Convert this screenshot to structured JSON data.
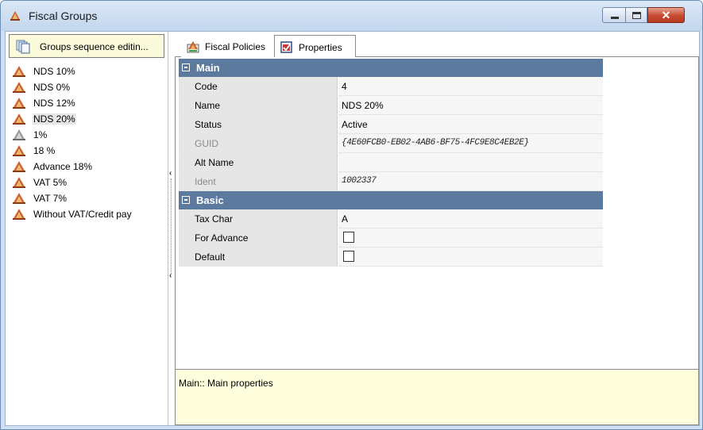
{
  "window": {
    "title": "Fiscal Groups",
    "buttons": {
      "minimize": "",
      "maximize": "",
      "close": "✕"
    }
  },
  "left_panel": {
    "sequence_button": "Groups sequence editin...",
    "items": [
      {
        "label": "NDS 10%",
        "icon": "fiscal-group-icon"
      },
      {
        "label": "NDS 0%",
        "icon": "fiscal-group-icon"
      },
      {
        "label": "NDS 12%",
        "icon": "fiscal-group-icon"
      },
      {
        "label": "NDS 20%",
        "icon": "fiscal-group-icon",
        "selected": true
      },
      {
        "label": "1%",
        "icon": "fiscal-group-disabled-icon"
      },
      {
        "label": "18 %",
        "icon": "fiscal-group-icon"
      },
      {
        "label": "Advance 18%",
        "icon": "fiscal-group-icon"
      },
      {
        "label": "VAT 5%",
        "icon": "fiscal-group-icon"
      },
      {
        "label": "VAT 7%",
        "icon": "fiscal-group-icon"
      },
      {
        "label": "Without VAT/Credit pay",
        "icon": "fiscal-group-icon"
      }
    ]
  },
  "splitter": {
    "arrow_top": "‹",
    "arrow_bottom": "‹"
  },
  "tabs": [
    {
      "label": "Fiscal Policies",
      "icon": "fiscal-policies-icon"
    },
    {
      "label": "Properties",
      "icon": "properties-icon",
      "active": true
    }
  ],
  "property_grid": {
    "main": {
      "category": "Main",
      "rows": {
        "code": {
          "name": "Code",
          "value": "4"
        },
        "name": {
          "name": "Name",
          "value": "NDS 20%"
        },
        "status": {
          "name": "Status",
          "value": "Active"
        },
        "guid": {
          "name": "GUID",
          "value": "{4E60FCB0-EB02-4AB6-BF75-4FC9E8C4EB2E}"
        },
        "alt_name": {
          "name": "Alt Name",
          "value": ""
        },
        "ident": {
          "name": "Ident",
          "value": "1002337"
        }
      }
    },
    "basic": {
      "category": "Basic",
      "rows": {
        "tax_char": {
          "name": "Tax Char",
          "value": "A"
        },
        "for_advance": {
          "name": "For Advance",
          "checked": false
        },
        "default": {
          "name": "Default",
          "checked": false
        }
      }
    }
  },
  "description": "Main:: Main properties",
  "colors": {
    "category_header": "#5b7a9e",
    "description_bg": "#fefedc",
    "titlebar": "#c2d6ee",
    "close_button": "#c44a30"
  }
}
